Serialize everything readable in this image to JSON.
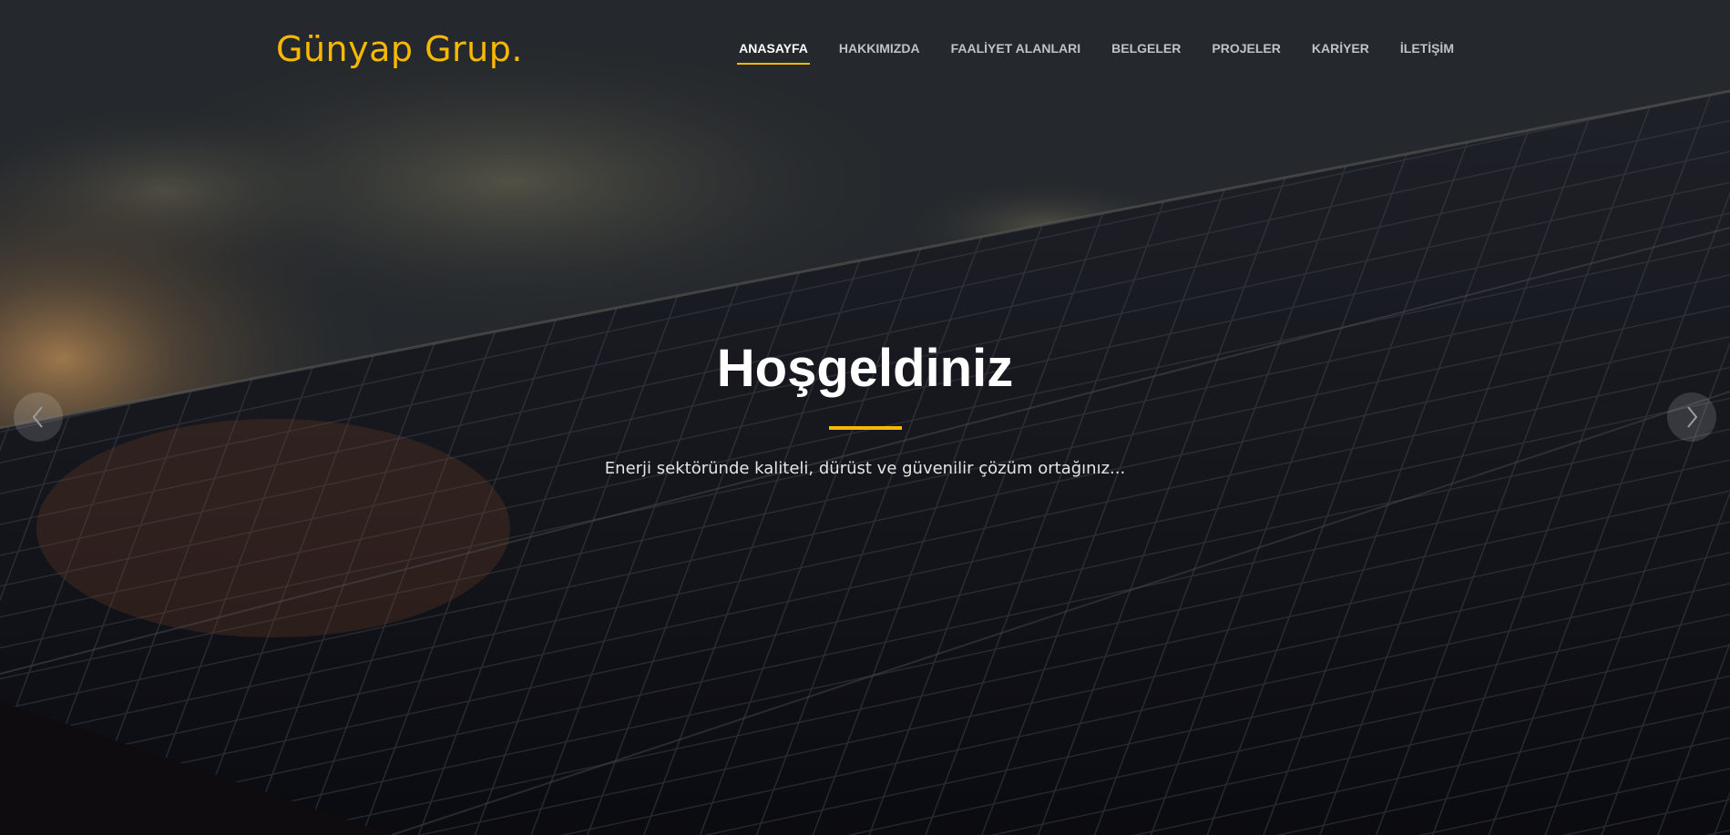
{
  "header": {
    "logo_text": "Günyap Grup.",
    "nav": [
      {
        "label": "ANASAYFA",
        "active": true
      },
      {
        "label": "HAKKIMIZDA",
        "active": false
      },
      {
        "label": "FAALİYET ALANLARI",
        "active": false
      },
      {
        "label": "BELGELER",
        "active": false
      },
      {
        "label": "PROJELER",
        "active": false
      },
      {
        "label": "KARİYER",
        "active": false
      },
      {
        "label": "İLETİŞİM",
        "active": false
      }
    ]
  },
  "hero": {
    "title": "Hoşgeldiniz",
    "subtitle": "Enerji sektöründe kaliteli, dürüst ve güvenilir çözüm ortağınız..."
  },
  "slider": {
    "prev_icon": "chevron-left-icon",
    "next_icon": "chevron-right-icon"
  },
  "colors": {
    "accent": "#f6b800",
    "nav_text": "#bfc2c6",
    "nav_active": "#ffffff"
  }
}
